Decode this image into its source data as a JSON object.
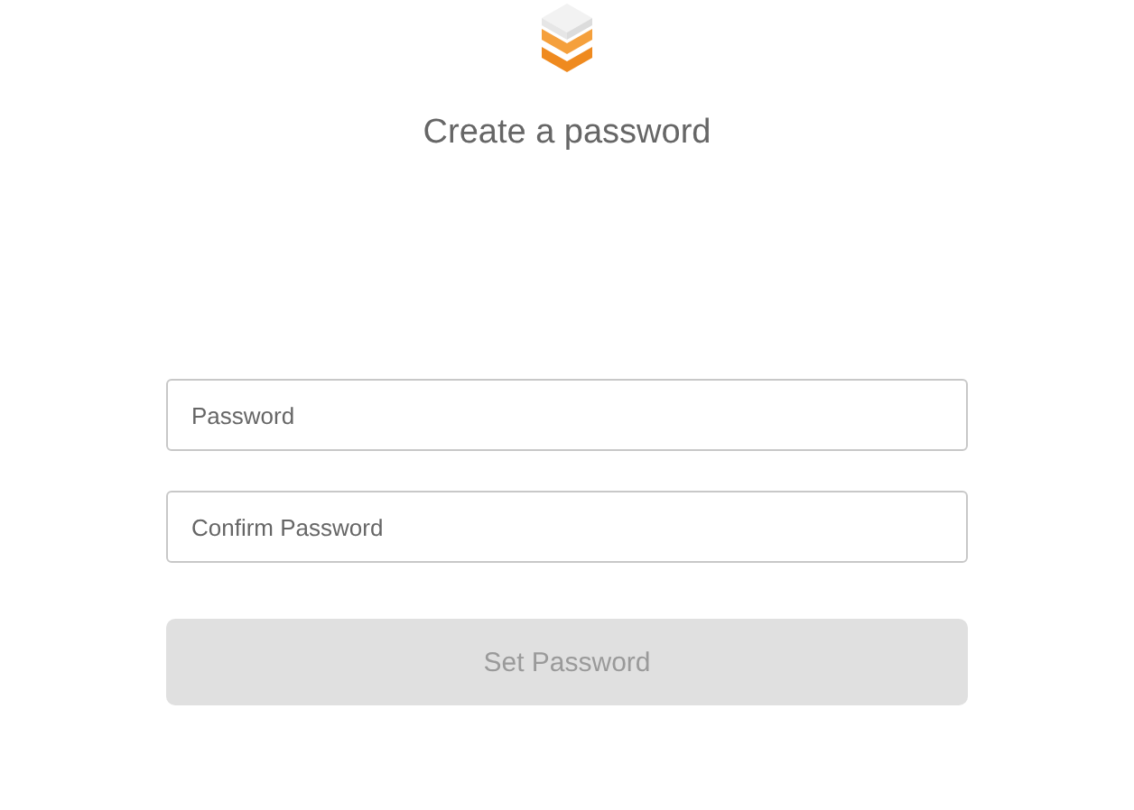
{
  "title": "Create a password",
  "fields": [
    {
      "placeholder": "Password"
    },
    {
      "placeholder": "Confirm Password"
    }
  ],
  "button": {
    "label": "Set Password",
    "disabled": true
  }
}
